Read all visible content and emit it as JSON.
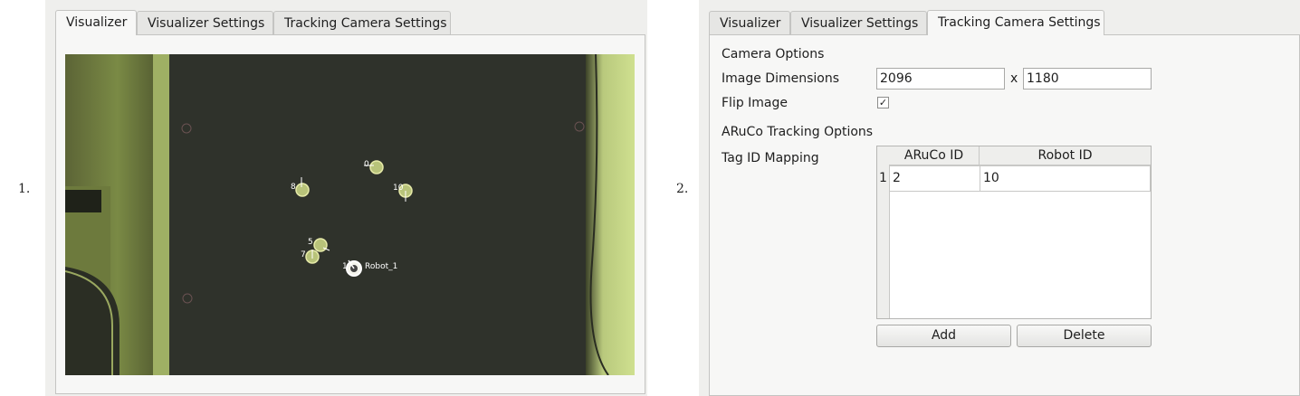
{
  "items": [
    {
      "number": "1.",
      "tabs": [
        "Visualizer",
        "Visualizer Settings",
        "Tracking Camera Settings"
      ],
      "active_tab": "Visualizer",
      "markers": [
        "0",
        "8",
        "10",
        "5",
        "7",
        "1"
      ],
      "robot_label": "Robot_1"
    },
    {
      "number": "2.",
      "tabs": [
        "Visualizer",
        "Visualizer Settings",
        "Tracking Camera Settings"
      ],
      "active_tab": "Tracking Camera Settings",
      "camera_options_heading": "Camera Options",
      "image_dimensions_label": "Image Dimensions",
      "width_value": "2096",
      "dim_separator": "x",
      "height_value": "1180",
      "flip_image_label": "Flip Image",
      "flip_image_checked": "✓",
      "aruco_heading": "ARuCo Tracking Options",
      "tag_mapping_label": "Tag ID Mapping",
      "table_headers": [
        "ARuCo ID",
        "Robot ID"
      ],
      "table_rows": [
        {
          "row_num": "1",
          "aruco_id": "2",
          "robot_id": "10"
        }
      ],
      "add_button": "Add",
      "delete_button": "Delete"
    }
  ]
}
